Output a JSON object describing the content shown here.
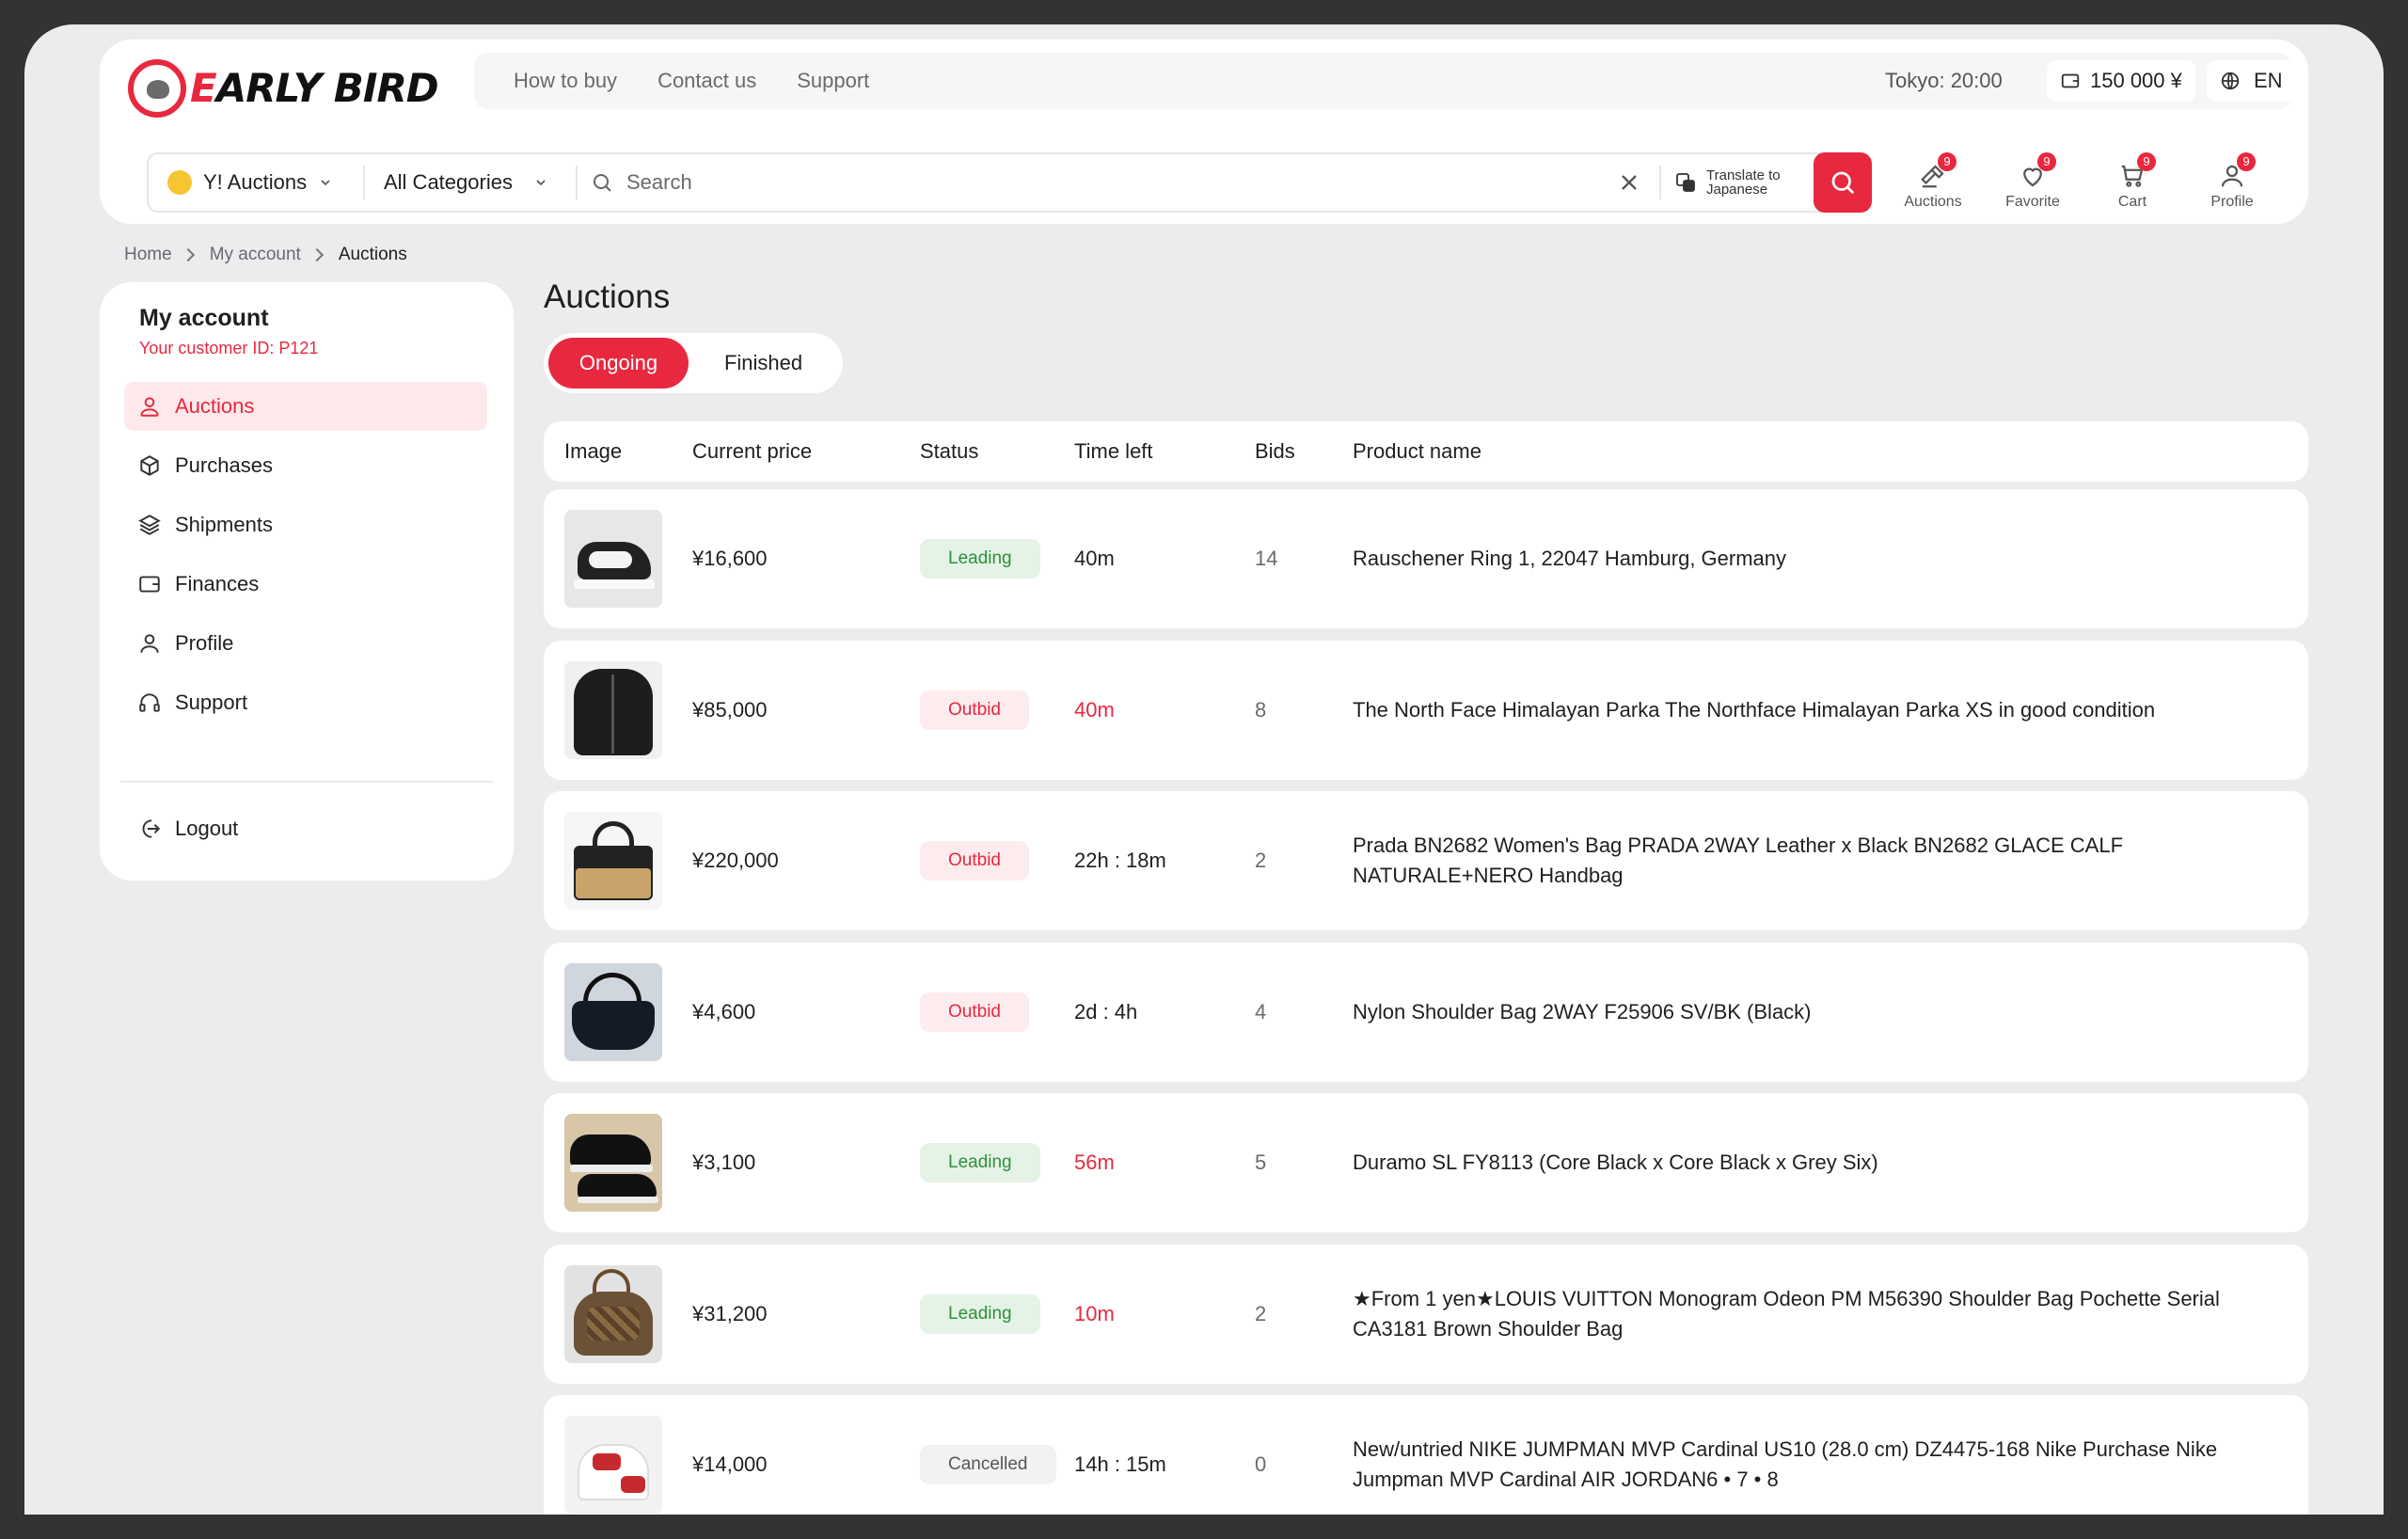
{
  "brand": {
    "logo_text_first": "E",
    "logo_text_rest": "ARLY BIRD"
  },
  "topnav": [
    "How to buy",
    "Contact us",
    "Support"
  ],
  "tokyo_time": "Tokyo: 20:00",
  "balance": "150 000 ¥",
  "language": "EN",
  "search": {
    "site": "Y! Auctions",
    "category": "All Categories",
    "placeholder": "Search",
    "translate_line1": "Translate to",
    "translate_line2": "Japanese"
  },
  "icon_nav": [
    {
      "label": "Auctions",
      "badge": "9",
      "icon": "auction-icon"
    },
    {
      "label": "Favorite",
      "badge": "9",
      "icon": "heart-icon"
    },
    {
      "label": "Cart",
      "badge": "9",
      "icon": "cart-icon"
    },
    {
      "label": "Profile",
      "badge": "9",
      "icon": "user-icon"
    }
  ],
  "breadcrumb": [
    "Home",
    "My account",
    "Auctions"
  ],
  "sidebar": {
    "title": "My account",
    "customer_id": "Your customer ID: P121",
    "items": [
      {
        "label": "Auctions",
        "icon": "auction-icon",
        "active": true
      },
      {
        "label": "Purchases",
        "icon": "box-icon"
      },
      {
        "label": "Shipments",
        "icon": "layers-icon"
      },
      {
        "label": "Finances",
        "icon": "wallet-icon"
      },
      {
        "label": "Profile",
        "icon": "user-icon"
      },
      {
        "label": "Support",
        "icon": "headset-icon"
      }
    ],
    "logout": "Logout"
  },
  "main": {
    "title": "Auctions",
    "tabs": [
      "Ongoing",
      "Finished"
    ],
    "columns": [
      "Image",
      "Current price",
      "Status",
      "Time left",
      "Bids",
      "Product name"
    ],
    "rows": [
      {
        "price": "¥16,600",
        "status": "Leading",
        "time_left": "40m",
        "time_urgent": false,
        "bids": "14",
        "name": "Rauschener Ring 1, 22047 Hamburg, Germany",
        "thumb": "sneaker"
      },
      {
        "price": "¥85,000",
        "status": "Outbid",
        "time_left": "40m",
        "time_urgent": true,
        "bids": "8",
        "name": "The North Face Himalayan Parka The Northface Himalayan Parka XS in good condition",
        "thumb": "jacket"
      },
      {
        "price": "¥220,000",
        "status": "Outbid",
        "time_left": "22h : 18m",
        "time_urgent": false,
        "bids": "2",
        "name": "Prada BN2682 Women's Bag PRADA 2WAY Leather x Black BN2682 GLACE CALF NATURALE+NERO Handbag",
        "thumb": "handbag"
      },
      {
        "price": "¥4,600",
        "status": "Outbid",
        "time_left": "2d : 4h",
        "time_urgent": false,
        "bids": "4",
        "name": "Nylon Shoulder Bag 2WAY F25906 SV/BK (Black)",
        "thumb": "shoulderbag"
      },
      {
        "price": "¥3,100",
        "status": "Leading",
        "time_left": "56m",
        "time_urgent": true,
        "bids": "5",
        "name": "Duramo SL FY8113 (Core Black x Core Black x Grey Six)",
        "thumb": "shoes"
      },
      {
        "price": "¥31,200",
        "status": "Leading",
        "time_left": "10m",
        "time_urgent": true,
        "bids": "2",
        "name": "★From 1 yen★LOUIS VUITTON Monogram Odeon PM M56390 Shoulder Bag Pochette Serial CA3181 Brown Shoulder Bag",
        "thumb": "monogram"
      },
      {
        "price": "¥14,000",
        "status": "Cancelled",
        "time_left": "14h : 15m",
        "time_urgent": false,
        "bids": "0",
        "name": "New/untried NIKE JUMPMAN MVP Cardinal US10 (28.0 cm) DZ4475-168 Nike Purchase Nike Jumpman MVP Cardinal AIR JORDAN6 • 7 • 8",
        "thumb": "jordan"
      }
    ]
  },
  "colors": {
    "accent": "#e8283f",
    "leading": "#2f8f3c",
    "page_bg": "#ececee"
  }
}
